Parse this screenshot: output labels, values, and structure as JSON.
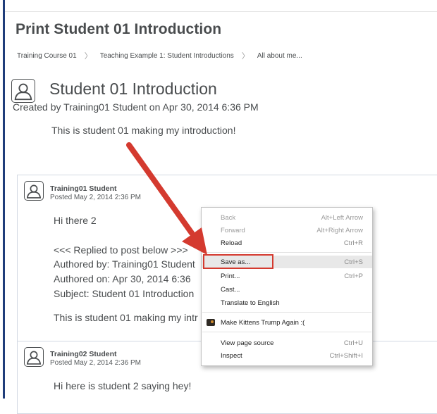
{
  "page": {
    "title": "Print Student 01 Introduction"
  },
  "breadcrumb": {
    "items": [
      "Training Course 01",
      "Teaching Example 1: Student Introductions",
      "All about me..."
    ],
    "separator": "〉"
  },
  "topic": {
    "title": "Student 01 Introduction",
    "created_by": "Created by Training01 Student on Apr 30, 2014 6:36 PM",
    "body": "This is student 01 making my introduction!"
  },
  "posts": [
    {
      "author": "Training01 Student",
      "posted": "Posted May 2, 2014 2:36 PM",
      "lines": [
        "Hi there 2",
        "<<< Replied to post below >>>",
        "Authored by: Training01 Student",
        "Authored on: Apr 30, 2014 6:36",
        "Subject: Student 01 Introduction",
        "This is student 01 making my intr"
      ]
    },
    {
      "author": "Training02 Student",
      "posted": "Posted May 2, 2014 2:36 PM",
      "lines": [
        "Hi here is student 2 saying hey!"
      ]
    }
  ],
  "context_menu": {
    "items": [
      {
        "label": "Back",
        "shortcut": "Alt+Left Arrow",
        "disabled": true
      },
      {
        "label": "Forward",
        "shortcut": "Alt+Right Arrow",
        "disabled": true
      },
      {
        "label": "Reload",
        "shortcut": "Ctrl+R"
      },
      {
        "label": "Save as...",
        "shortcut": "Ctrl+S",
        "highlighted": true
      },
      {
        "label": "Print...",
        "shortcut": "Ctrl+P"
      },
      {
        "label": "Cast..."
      },
      {
        "label": "Translate to English"
      },
      {
        "label": "Make Kittens Trump Again :(",
        "icon": "kitten-extension-icon"
      },
      {
        "label": "View page source",
        "shortcut": "Ctrl+U"
      },
      {
        "label": "Inspect",
        "shortcut": "Ctrl+Shift+I"
      }
    ]
  },
  "colors": {
    "accent_bar": "#1f3d7a",
    "annotation_red": "#d43a2f",
    "text_gray": "#494c4e"
  }
}
